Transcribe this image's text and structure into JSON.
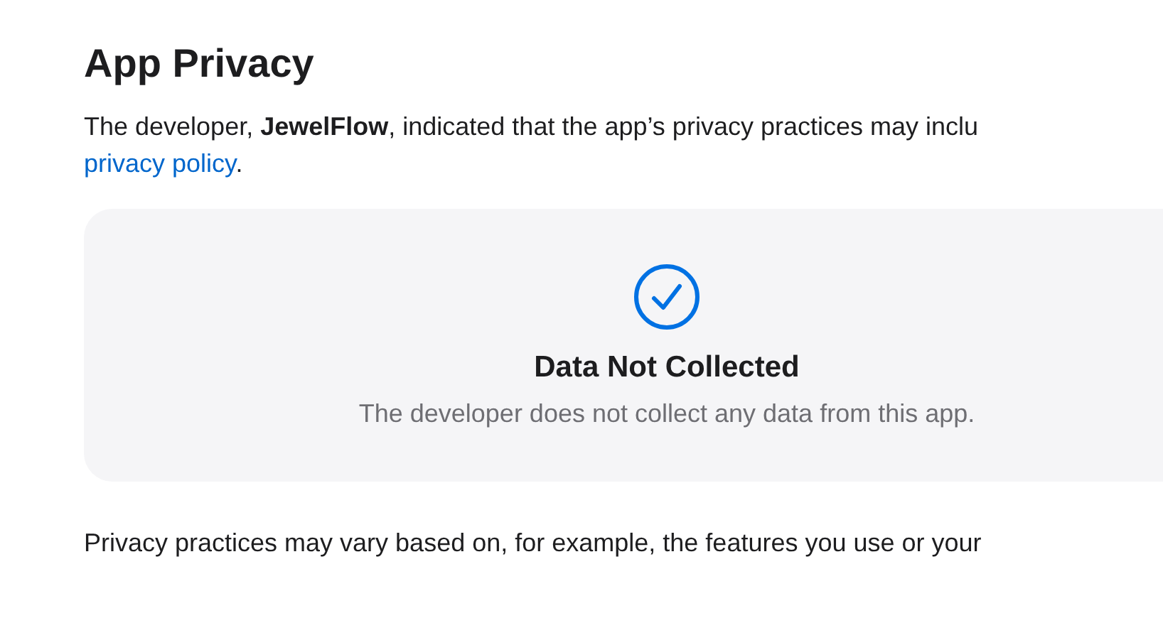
{
  "heading": "App Privacy",
  "intro": {
    "text": "The developer, **JewelFlow**, indicated that the app’s privacy practices may inclu",
    "link": "privacy policy",
    "after": "."
  },
  "card": {
    "title": "Data Not Collected",
    "description": "The developer does not collect any data from this app."
  },
  "footnote": "Privacy practices may vary based on, for example, the features you use or your"
}
